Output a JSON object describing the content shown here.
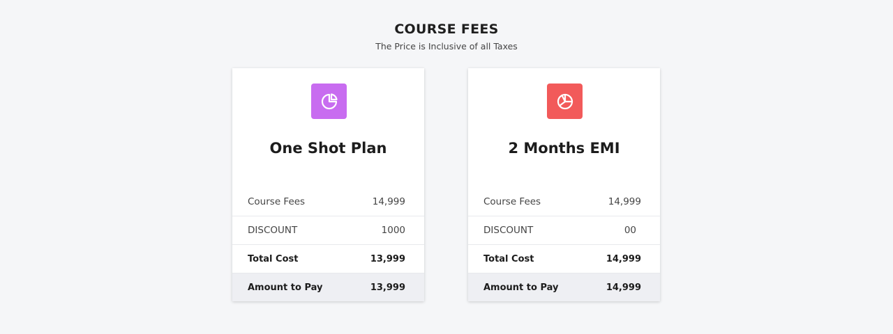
{
  "header": {
    "title": "COURSE FEES",
    "subtitle": "The Price is Inclusive of all Taxes"
  },
  "plans": [
    {
      "icon": "pie-chart-icon",
      "icon_color": "#c86cf0",
      "title": "One Shot Plan",
      "rows": [
        {
          "label": "Course Fees",
          "value": "14,999"
        },
        {
          "label": "DISCOUNT",
          "value": "1000"
        },
        {
          "label": "Total Cost",
          "value": "13,999"
        },
        {
          "label": "Amount to Pay",
          "value": "13,999"
        }
      ]
    },
    {
      "icon": "segmented-circle-icon",
      "icon_color": "#f25a5a",
      "title": "2 Months EMI",
      "rows": [
        {
          "label": "Course Fees",
          "value": "14,999"
        },
        {
          "label": "DISCOUNT",
          "value": "00"
        },
        {
          "label": "Total Cost",
          "value": "14,999"
        },
        {
          "label": "Amount to Pay",
          "value": "14,999"
        }
      ]
    }
  ]
}
